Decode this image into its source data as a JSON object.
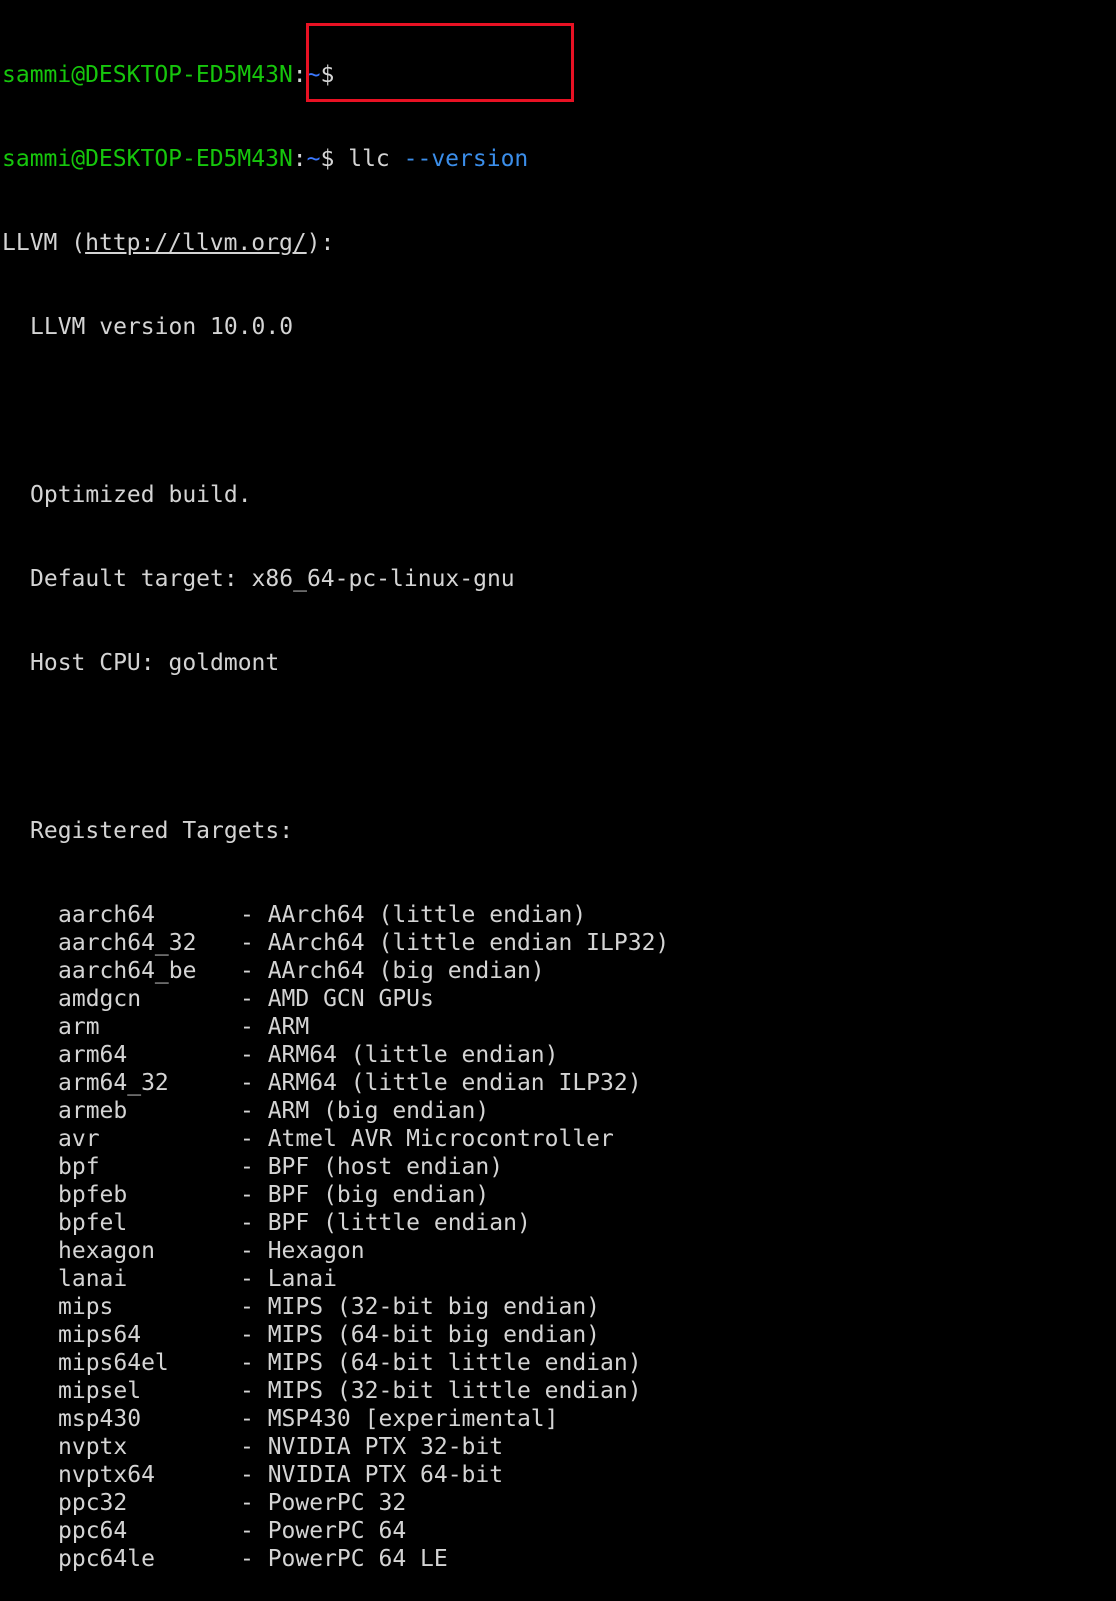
{
  "prompt": {
    "user_host": "sammi@DESKTOP-ED5M43N",
    "colon": ":",
    "path": "~",
    "symbol": "$"
  },
  "command": {
    "name": "llc",
    "flag": "--version"
  },
  "output": {
    "llvm_prefix": "LLVM (",
    "llvm_url": "http://llvm.org/",
    "llvm_suffix": "):",
    "version_line": "LLVM version 10.0.0",
    "build_line": "Optimized build.",
    "default_target_line": "Default target: x86_64-pc-linux-gnu",
    "host_cpu_line": "Host CPU: goldmont",
    "registered_targets_header": "Registered Targets:"
  },
  "targets": [
    {
      "name": "aarch64",
      "desc": "- AArch64 (little endian)"
    },
    {
      "name": "aarch64_32",
      "desc": "- AArch64 (little endian ILP32)"
    },
    {
      "name": "aarch64_be",
      "desc": "- AArch64 (big endian)"
    },
    {
      "name": "amdgcn",
      "desc": "- AMD GCN GPUs"
    },
    {
      "name": "arm",
      "desc": "- ARM"
    },
    {
      "name": "arm64",
      "desc": "- ARM64 (little endian)"
    },
    {
      "name": "arm64_32",
      "desc": "- ARM64 (little endian ILP32)"
    },
    {
      "name": "armeb",
      "desc": "- ARM (big endian)"
    },
    {
      "name": "avr",
      "desc": "- Atmel AVR Microcontroller"
    },
    {
      "name": "bpf",
      "desc": "- BPF (host endian)"
    },
    {
      "name": "bpfeb",
      "desc": "- BPF (big endian)"
    },
    {
      "name": "bpfel",
      "desc": "- BPF (little endian)"
    },
    {
      "name": "hexagon",
      "desc": "- Hexagon"
    },
    {
      "name": "lanai",
      "desc": "- Lanai"
    },
    {
      "name": "mips",
      "desc": "- MIPS (32-bit big endian)"
    },
    {
      "name": "mips64",
      "desc": "- MIPS (64-bit big endian)"
    },
    {
      "name": "mips64el",
      "desc": "- MIPS (64-bit little endian)"
    },
    {
      "name": "mipsel",
      "desc": "- MIPS (32-bit little endian)"
    },
    {
      "name": "msp430",
      "desc": "- MSP430 [experimental]"
    },
    {
      "name": "nvptx",
      "desc": "- NVIDIA PTX 32-bit"
    },
    {
      "name": "nvptx64",
      "desc": "- NVIDIA PTX 64-bit"
    },
    {
      "name": "ppc32",
      "desc": "- PowerPC 32"
    },
    {
      "name": "ppc64",
      "desc": "- PowerPC 64"
    },
    {
      "name": "ppc64le",
      "desc": "- PowerPC 64 LE"
    }
  ],
  "colors": {
    "background": "#000000",
    "text": "#d4d4d4",
    "prompt_user": "#16c60c",
    "prompt_path": "#3b78ff",
    "command_flag": "#3b8eea",
    "highlight_box": "#e81123"
  }
}
